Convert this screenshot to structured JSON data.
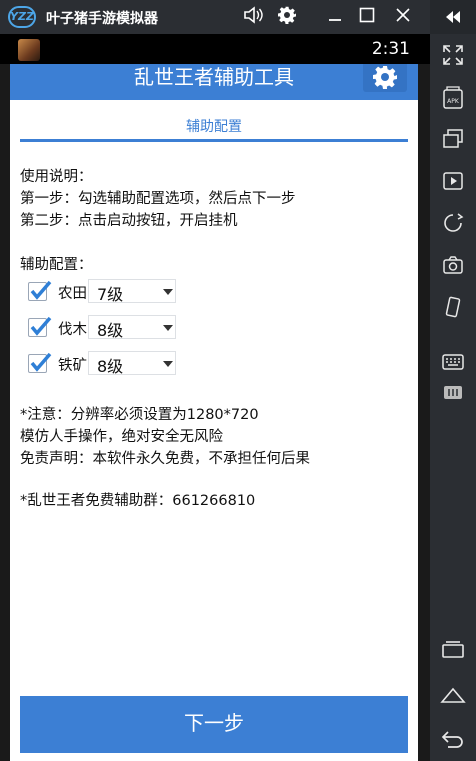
{
  "emulator": {
    "logo": "YZZ",
    "title": "叶子猪手游模拟器",
    "titlebar_icons": [
      "volume-icon",
      "gear-icon",
      "minimize-icon",
      "maximize-icon",
      "close-icon"
    ],
    "side_icons": [
      "collapse-icon",
      "fullscreen-icon",
      "apk-icon",
      "multi-window-icon",
      "video-icon",
      "rotate-icon",
      "screenshot-icon",
      "shake-icon",
      "keyboard-icon",
      "more-icon",
      "recent-apps-icon",
      "home-icon",
      "back-icon"
    ]
  },
  "statusbar": {
    "time": "2:31"
  },
  "app": {
    "title": "乱世王者辅助工具",
    "tab": "辅助配置",
    "instructions": {
      "heading": "使用说明：",
      "step1": "第一步：勾选辅助配置选项，然后点下一步",
      "step2": "第二步：点击启动按钮，开启挂机"
    },
    "config": {
      "heading": "辅助配置：",
      "options": [
        {
          "label": "农田",
          "checked": true,
          "level": "7级"
        },
        {
          "label": "伐木",
          "checked": true,
          "level": "8级"
        },
        {
          "label": "铁矿",
          "checked": true,
          "level": "8级"
        }
      ]
    },
    "notes": {
      "line1": "*注意：分辨率必须设置为1280*720",
      "line2": "模仿人手操作，绝对安全无风险",
      "line3": "免责声明：本软件永久免费，不承担任何后果",
      "group": "*乱世王者免费辅助群：661266810"
    },
    "next_button": "下一步"
  },
  "colors": {
    "accent": "#3c7fd4",
    "emulator_chrome": "#2b2e33",
    "checkbox": "#2f7fd6"
  }
}
